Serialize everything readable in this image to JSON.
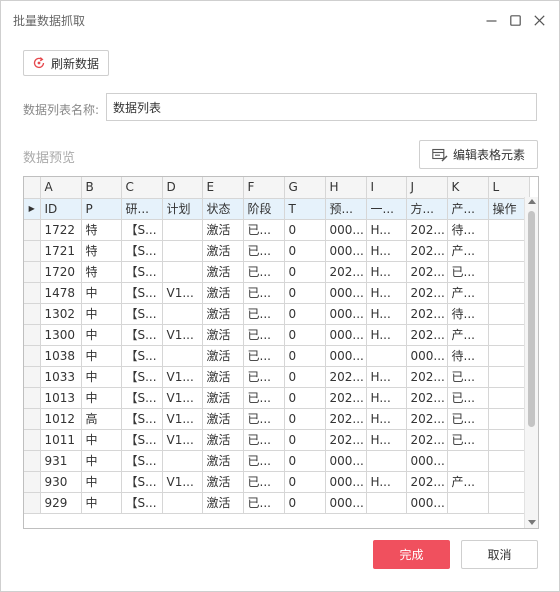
{
  "window": {
    "title": "批量数据抓取"
  },
  "toolbar": {
    "refresh_label": "刷新数据",
    "refresh_icon": "refresh-icon"
  },
  "form": {
    "name_label": "数据列表名称:",
    "name_value": "数据列表"
  },
  "preview": {
    "label": "数据预览",
    "edit_label": "编辑表格元素",
    "edit_icon": "edit-table-icon"
  },
  "grid": {
    "row_marker": "▶",
    "column_letters": [
      "A",
      "B",
      "C",
      "D",
      "E",
      "F",
      "G",
      "H",
      "I",
      "J",
      "K",
      "L"
    ],
    "headers": [
      "ID",
      "P",
      "研...",
      "计划",
      "状态",
      "阶段",
      "T",
      "预...",
      "一...",
      "方...",
      "产...",
      "操作"
    ],
    "rows": [
      [
        "1722",
        "特",
        "【S...",
        "",
        "激活",
        "已...",
        "0",
        "000...",
        "H...",
        "202...",
        "待...",
        ""
      ],
      [
        "1721",
        "特",
        "【S...",
        "",
        "激活",
        "已...",
        "0",
        "000...",
        "H...",
        "202...",
        "产...",
        ""
      ],
      [
        "1720",
        "特",
        "【S...",
        "",
        "激活",
        "已...",
        "0",
        "202...",
        "H...",
        "202...",
        "已...",
        ""
      ],
      [
        "1478",
        "中",
        "【S...",
        "V1...",
        "激活",
        "已...",
        "0",
        "000...",
        "H...",
        "202...",
        "产...",
        ""
      ],
      [
        "1302",
        "中",
        "【S...",
        "",
        "激活",
        "已...",
        "0",
        "000...",
        "H...",
        "202...",
        "待...",
        ""
      ],
      [
        "1300",
        "中",
        "【S...",
        "V1...",
        "激活",
        "已...",
        "0",
        "000...",
        "H...",
        "202...",
        "产...",
        ""
      ],
      [
        "1038",
        "中",
        "【S...",
        "",
        "激活",
        "已...",
        "0",
        "000...",
        "",
        "000...",
        "待...",
        ""
      ],
      [
        "1033",
        "中",
        "【S...",
        "V1...",
        "激活",
        "已...",
        "0",
        "202...",
        "H...",
        "202...",
        "已...",
        ""
      ],
      [
        "1013",
        "中",
        "【S...",
        "V1...",
        "激活",
        "已...",
        "0",
        "202...",
        "H...",
        "202...",
        "已...",
        ""
      ],
      [
        "1012",
        "高",
        "【S...",
        "V1...",
        "激活",
        "已...",
        "0",
        "202...",
        "H...",
        "202...",
        "已...",
        ""
      ],
      [
        "1011",
        "中",
        "【S...",
        "V1...",
        "激活",
        "已...",
        "0",
        "202...",
        "H...",
        "202...",
        "已...",
        ""
      ],
      [
        "931",
        "中",
        "【S...",
        "",
        "激活",
        "已...",
        "0",
        "000...",
        "",
        "000...",
        "",
        ""
      ],
      [
        "930",
        "中",
        "【S...",
        "V1...",
        "激活",
        "已...",
        "0",
        "000...",
        "H...",
        "202...",
        "产...",
        ""
      ],
      [
        "929",
        "中",
        "【S...",
        "",
        "激活",
        "已...",
        "0",
        "000...",
        "",
        "000...",
        "",
        ""
      ]
    ]
  },
  "footer": {
    "done_label": "完成",
    "cancel_label": "取消"
  },
  "colors": {
    "accent": "#f0505e",
    "header_row": "#e6f2fb"
  }
}
